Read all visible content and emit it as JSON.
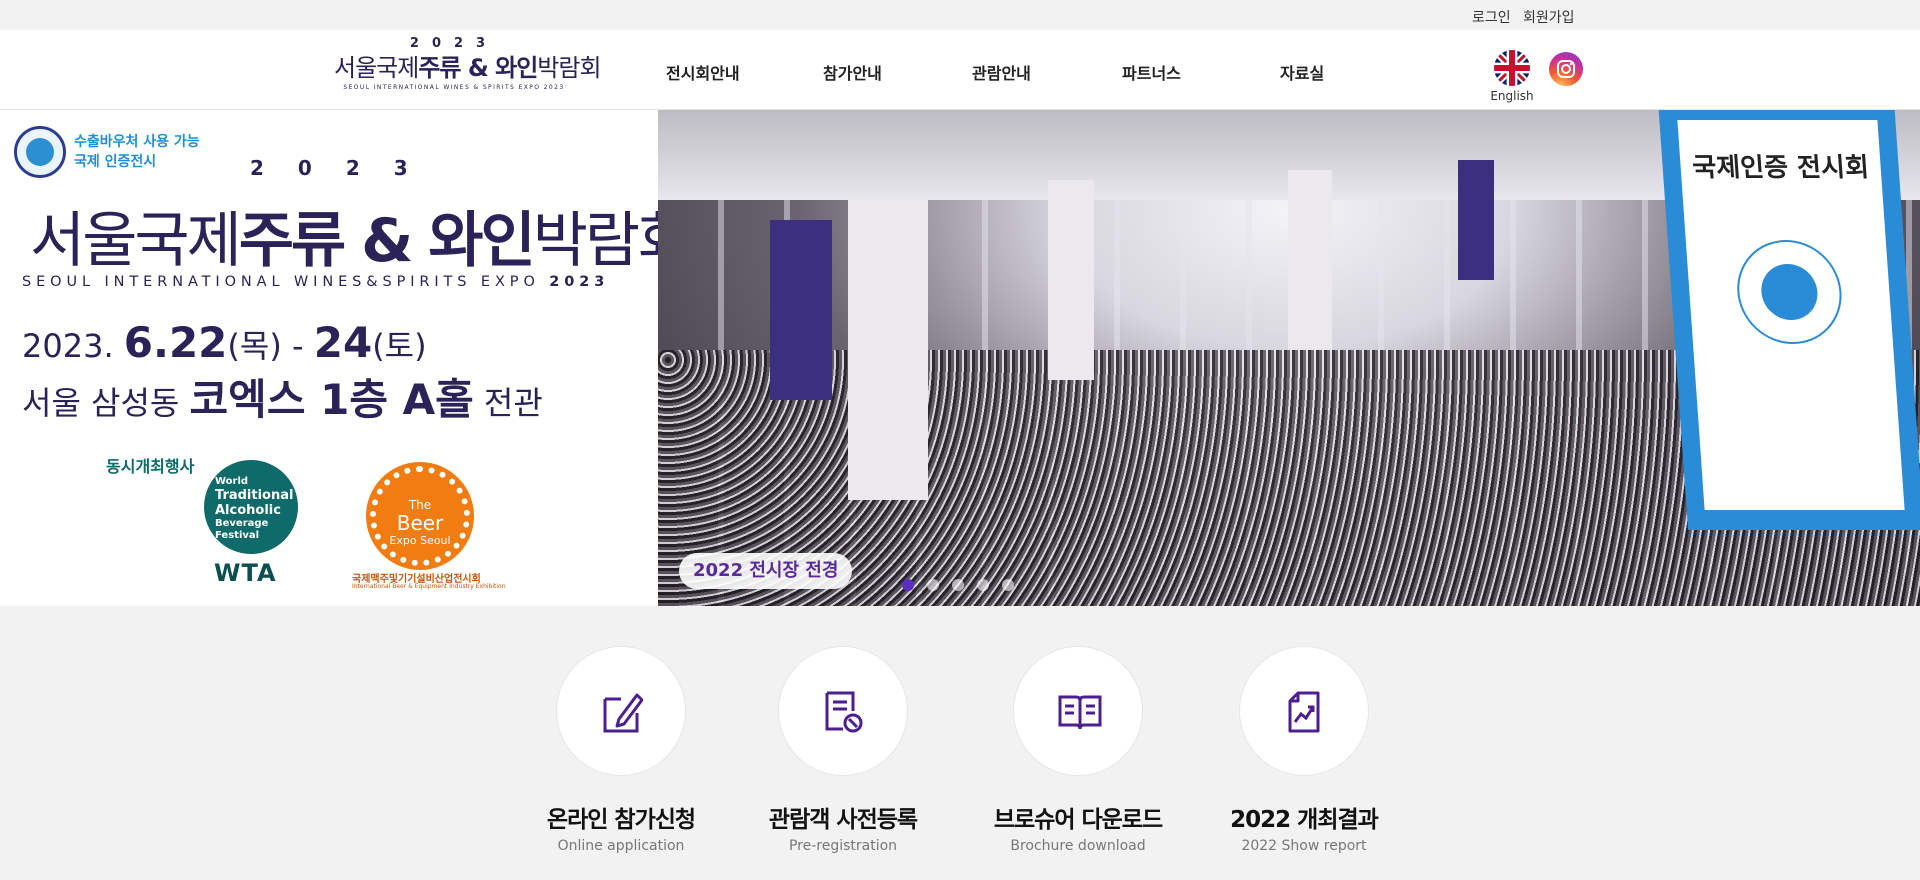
{
  "topbar": {
    "login": "로그인",
    "join": "회원가입"
  },
  "logo": {
    "year": "2023",
    "name_kr_a": "서울국제",
    "name_kr_b": "주류 & 와인",
    "name_kr_c": "박람회",
    "name_en": "SEOUL INTERNATIONAL WINES & SPIRITS EXPO 2023"
  },
  "nav": {
    "items": [
      {
        "label": "전시회안내"
      },
      {
        "label": "참가안내"
      },
      {
        "label": "관람안내"
      },
      {
        "label": "파트너스"
      },
      {
        "label": "자료실"
      }
    ]
  },
  "lang": {
    "label": "English",
    "icon": "uk-flag-icon"
  },
  "social": {
    "icon": "instagram-icon"
  },
  "hero": {
    "badge_line1": "수출바우처 사용 가능",
    "badge_line2": "국제 인증전시",
    "year": "2023",
    "title_a": "서울국제",
    "title_b": "주류 & 와인",
    "title_c": "박람회",
    "subtitle_en": "SEOUL INTERNATIONAL WINES&SPIRITS EXPO",
    "subtitle_year": "2023",
    "date_prefix": "2023.",
    "date_day1": "6.22",
    "date_mid": "(목) -",
    "date_day2": "24",
    "date_suffix": "(토)",
    "venue_prefix": "서울 삼성동",
    "venue_big": "코엑스 1층 A홀",
    "venue_suffix": "전관",
    "co_event_title": "동시개최행사",
    "wta_lines": [
      "World",
      "Traditional",
      "Alcoholic",
      "Beverage",
      "Festival"
    ],
    "wta_text": "WTA",
    "beer_logo_line1": "The",
    "beer_logo_line2": "Beer",
    "beer_logo_line3": "Expo Seoul",
    "beer_caption": "국제맥주및기기설비산업전시회",
    "beer_sub": "International Beer & Equipment Industry Exhibition",
    "photo_banner_title": "국제인증 전시회",
    "photo_caption": "2022 전시장 전경",
    "slide_count": 5,
    "active_slide": 1
  },
  "quick": [
    {
      "title": "온라인 참가신청",
      "sub": "Online application",
      "icon": "edit-document-icon"
    },
    {
      "title": "관람객 사전등록",
      "sub": "Pre-registration",
      "icon": "registration-form-icon"
    },
    {
      "title": "브로슈어 다운로드",
      "sub": "Brochure download",
      "icon": "open-book-icon"
    },
    {
      "title": "2022 개최결과",
      "sub": "2022 Show report",
      "icon": "report-chart-icon"
    }
  ],
  "colors": {
    "brand": "#2b2358",
    "accent": "#5a2fbf",
    "badge": "#1f8fd6",
    "wta": "#0f6b6a",
    "beer": "#f07c12"
  }
}
